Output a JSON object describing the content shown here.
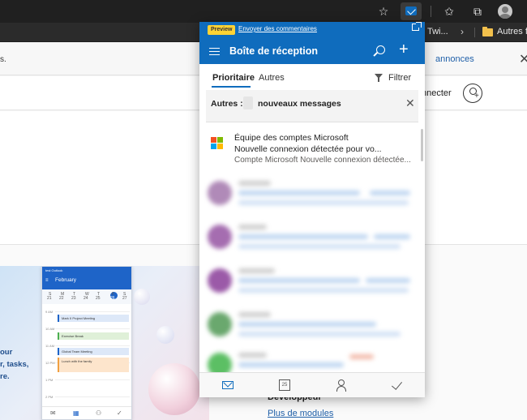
{
  "browser": {
    "favorites": {
      "item1": "Twi...",
      "folder": "Autres fa"
    }
  },
  "page": {
    "notice_left": "s.",
    "notice_link": "annonces",
    "signin": "nnecter",
    "promo_lines": [
      "our",
      "r, tasks,",
      "re."
    ],
    "developer_title": "Développeur",
    "more_modules": "Plus de modules"
  },
  "phone": {
    "app_name": "test Outlook",
    "month": "February",
    "day_letters": [
      "S",
      "M",
      "T",
      "W",
      "T",
      "F",
      "S"
    ],
    "day_numbers": [
      "21",
      "22",
      "23",
      "24",
      "25",
      "26",
      "27"
    ],
    "hours": [
      "9 AM",
      "10 AM",
      "11 AM",
      "12 PM",
      "1 PM",
      "2 PM",
      "3 PM",
      "4 PM"
    ],
    "events": [
      "Mark II Project Meeting",
      "Exercise Break",
      "Global Team Meeting",
      "Lunch with the family"
    ]
  },
  "outlook": {
    "preview_badge": "Preview",
    "feedback_link": "Envoyer des commentaires",
    "title": "Boîte de réception",
    "tabs": {
      "focused": "Prioritaire",
      "other": "Autres",
      "filter": "Filtrer"
    },
    "notice": {
      "label": "Autres :",
      "suffix": "nouveaux messages"
    },
    "message": {
      "sender": "Équipe des comptes Microsoft",
      "subject": "Nouvelle connexion détectée pour vo...",
      "preview": "Compte Microsoft Nouvelle connexion détectée..."
    },
    "blurred_avatar_colors": [
      "#b08ab8",
      "#a56db0",
      "#9b5aa8",
      "#6aa86e",
      "#5cbf64"
    ],
    "calendar_day": "25",
    "accent": "#0f6cbd"
  }
}
